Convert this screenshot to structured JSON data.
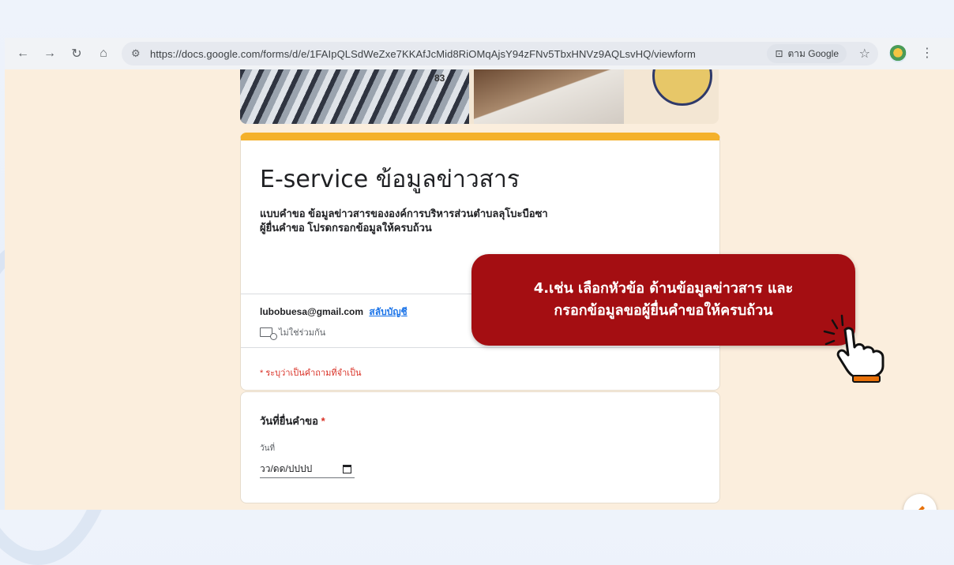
{
  "browser": {
    "url": "https://docs.google.com/forms/d/e/1FAIpQLSdWeZxe7KKAfJcMid8RiOMqAjsY94zFNv5TbxHNVz9AQLsvHQ/viewform",
    "lens_label": "ตาม Google"
  },
  "banner": {
    "label": "83"
  },
  "form": {
    "title": "E-service ข้อมูลข่าวสาร",
    "description_line1": "แบบคำขอ ข้อมูลข่าวสารขององค์การบริหารส่วนตำบลลุโบะบือซา",
    "description_line2": "ผู้ยื่นคำขอ โปรดกรอกข้อมูลให้ครบถ้วน",
    "email": "lubobuesa@gmail.com",
    "switch_account": "สลับบัญชี",
    "not_shared": "ไม่ใช่ร่วมกัน",
    "required_note": "* ระบุว่าเป็นคำถามที่จำเป็น"
  },
  "question": {
    "title": "วันที่ยื่นคำขอ",
    "required_mark": "*",
    "date_label": "วันที่",
    "date_placeholder": "วว/ดด/ปปปป"
  },
  "callout": {
    "line1": "4.เช่น เลือกหัวข้อ ด้านข้อมูลข่าวสาร และ",
    "line2": "กรอกข้อมูลขอผู้ยื่นคำขอให้ครบถ้วน"
  },
  "colors": {
    "accent": "#f4b12b",
    "callout": "#a40e12",
    "page_bg": "#fbeedd"
  }
}
